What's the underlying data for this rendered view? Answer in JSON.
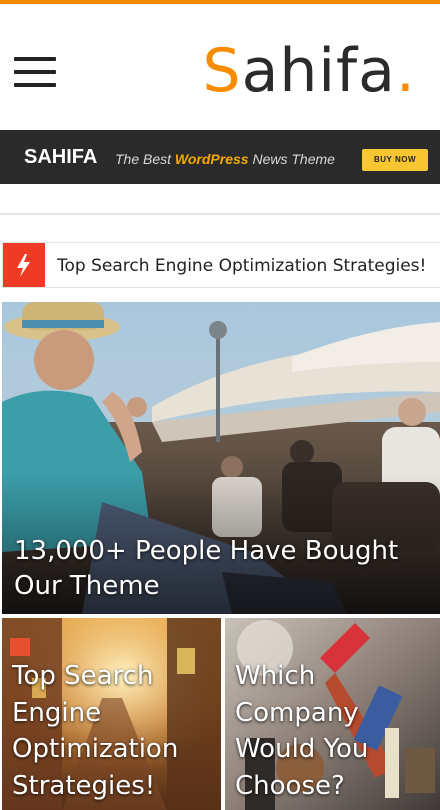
{
  "header": {
    "logo_first": "S",
    "logo_rest": "ahifa",
    "logo_dot": ".",
    "accent_color": "#f88c00"
  },
  "banner": {
    "brand": "SAHIFA",
    "tag_before": "The Best",
    "tag_highlight": "WordPress",
    "tag_after": "News Theme",
    "buy_label": "BUY NOW"
  },
  "ticker": {
    "icon": "lightning-icon",
    "headline": "Top Search Engine Optimization Strategies!"
  },
  "posts": {
    "featured": {
      "title": "13,000+ People Have Bought Our Theme"
    },
    "grid": [
      {
        "title": "Top Search Engine Optimization Strategies!"
      },
      {
        "title": "Which Company Would You Choose?"
      }
    ]
  }
}
